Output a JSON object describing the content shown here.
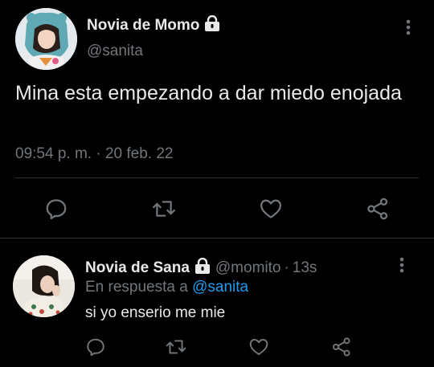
{
  "main_tweet": {
    "author_name": "Novia de Momo",
    "handle": "@sanita",
    "text": "Mina esta empezando a dar miedo enojada",
    "timestamp": "09:54 p. m. · 20 feb. 22",
    "actions": [
      "reply-icon",
      "retweet-icon",
      "like-icon",
      "share-icon"
    ]
  },
  "reply_tweet": {
    "author_name": "Novia de Sana",
    "handle": "@momito",
    "separator": "·",
    "time": "13s",
    "replying_prefix": "En respuesta a",
    "replying_handle": "@sanita",
    "text": "si yo enserio me mie",
    "actions": [
      "reply-icon",
      "retweet-icon",
      "like-icon",
      "share-icon"
    ]
  },
  "colors": {
    "background": "#000000",
    "primary_text": "#e7e9ea",
    "secondary_text": "#71767b",
    "link": "#1d9bf0",
    "divider": "#2f3336"
  }
}
